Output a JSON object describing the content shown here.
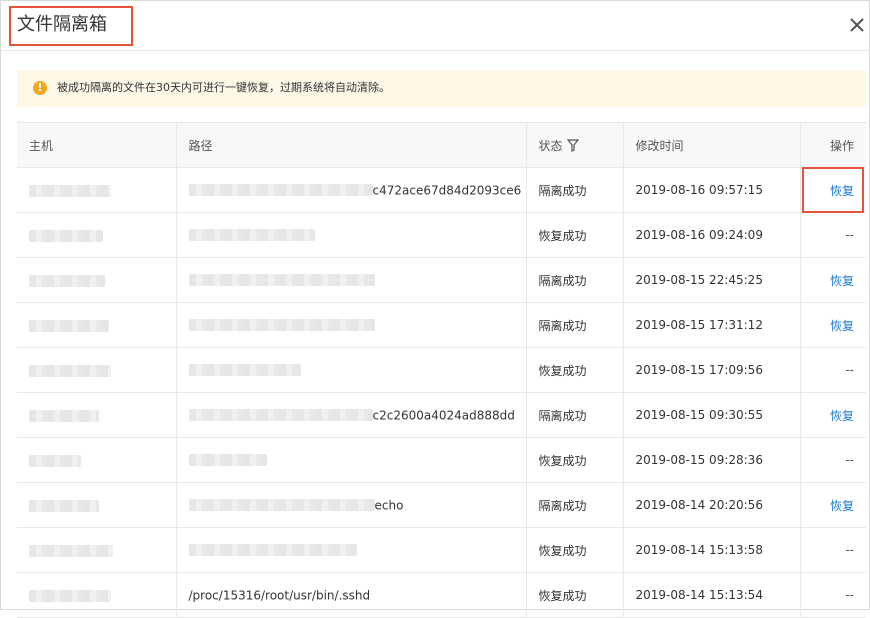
{
  "dialog": {
    "title": "文件隔离箱"
  },
  "notice": {
    "icon": "warning-icon",
    "text": "被成功隔离的文件在30天内可进行一键恢复，过期系统将自动清除。"
  },
  "table": {
    "columns": {
      "host": "主机",
      "path": "路径",
      "status": "状态",
      "mtime": "修改时间",
      "action": "操作"
    },
    "rows": [
      {
        "path_suffix": "c472ace67d84d2093ce6",
        "status": "隔离成功",
        "mtime": "2019-08-16 09:57:15",
        "action": "恢复"
      },
      {
        "path_suffix": "",
        "status": "恢复成功",
        "mtime": "2019-08-16 09:24:09",
        "action": "--"
      },
      {
        "path_suffix": "",
        "status": "隔离成功",
        "mtime": "2019-08-15 22:45:25",
        "action": "恢复"
      },
      {
        "path_suffix": "",
        "status": "隔离成功",
        "mtime": "2019-08-15 17:31:12",
        "action": "恢复"
      },
      {
        "path_suffix": "",
        "status": "恢复成功",
        "mtime": "2019-08-15 17:09:56",
        "action": "--"
      },
      {
        "path_suffix": "c2c2600a4024ad888dd",
        "status": "隔离成功",
        "mtime": "2019-08-15 09:30:55",
        "action": "恢复"
      },
      {
        "path_suffix": "",
        "status": "恢复成功",
        "mtime": "2019-08-15 09:28:36",
        "action": "--"
      },
      {
        "path_suffix": "echo",
        "status": "隔离成功",
        "mtime": "2019-08-14 20:20:56",
        "action": "恢复"
      },
      {
        "path_suffix": "",
        "status": "恢复成功",
        "mtime": "2019-08-14 15:13:58",
        "action": "--"
      },
      {
        "path_suffix": "/proc/15316/root/usr/bin/.sshd",
        "status": "恢复成功",
        "mtime": "2019-08-14 15:13:54",
        "action": "--"
      }
    ]
  },
  "colors": {
    "highlight": "#e4543c",
    "link": "#1b7bd6",
    "notice_bg": "#fdf7e6",
    "warning": "#f5a623"
  }
}
